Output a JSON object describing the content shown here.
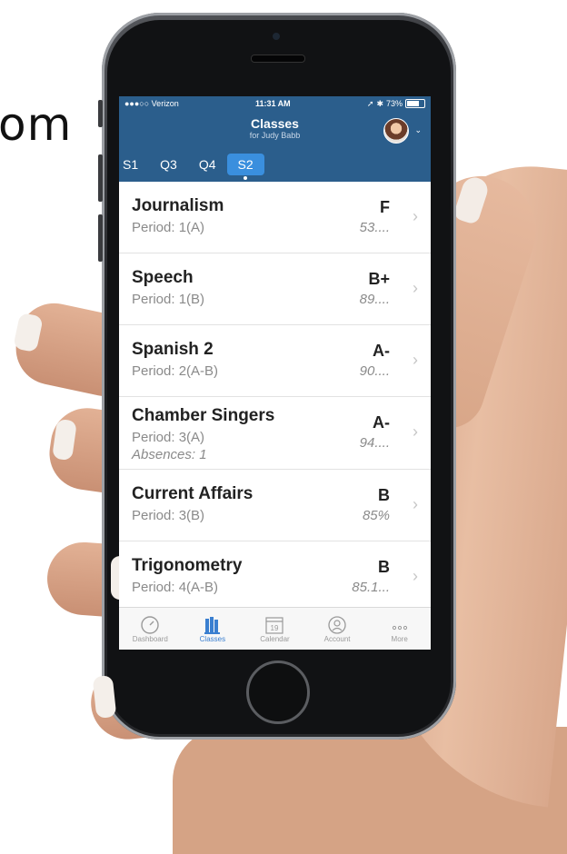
{
  "background_text": "om",
  "status_bar": {
    "carrier": "●●●○○ Verizon",
    "time": "11:31 AM",
    "battery": "73%"
  },
  "header": {
    "title": "Classes",
    "subtitle": "for Judy Babb"
  },
  "tabs": [
    "S1",
    "Q3",
    "Q4",
    "S2"
  ],
  "active_tab": "S2",
  "classes": [
    {
      "name": "Journalism",
      "period": "Period: 1(A)",
      "grade": "F",
      "percent": "53...."
    },
    {
      "name": "Speech",
      "period": "Period: 1(B)",
      "grade": "B+",
      "percent": "89...."
    },
    {
      "name": "Spanish 2",
      "period": "Period: 2(A-B)",
      "grade": "A-",
      "percent": "90...."
    },
    {
      "name": "Chamber Singers",
      "period": "Period: 3(A)",
      "absences": "Absences: 1",
      "grade": "A-",
      "percent": "94...."
    },
    {
      "name": "Current Affairs",
      "period": "Period: 3(B)",
      "grade": "B",
      "percent": "85%"
    },
    {
      "name": "Trigonometry",
      "period": "Period: 4(A-B)",
      "grade": "B",
      "percent": "85.1..."
    }
  ],
  "tabbar": {
    "items": [
      {
        "label": "Dashboard",
        "icon": "gauge-icon"
      },
      {
        "label": "Classes",
        "icon": "books-icon"
      },
      {
        "label": "Calendar",
        "icon": "calendar-icon",
        "day": "19"
      },
      {
        "label": "Account",
        "icon": "account-icon"
      },
      {
        "label": "More",
        "icon": "more-icon"
      }
    ],
    "active": "Classes"
  },
  "colors": {
    "header": "#2b5e8c",
    "active_tab": "#3a8fde",
    "tab_active": "#3a7fd0"
  }
}
